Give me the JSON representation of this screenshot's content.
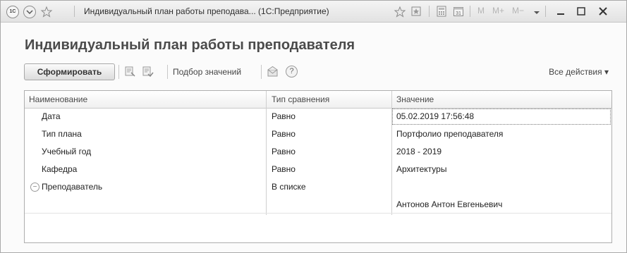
{
  "titlebar": {
    "logo_text": "1С",
    "title": "Индивидуальный план работы преподава...  (1С:Предприятие)",
    "memory_buttons": [
      "M",
      "M+",
      "M−"
    ],
    "icons": [
      "back-icon",
      "star-icon",
      "favorites-icon",
      "bookmark-icon",
      "calculator-icon",
      "calendar-icon",
      "dropdown-icon",
      "minimize-icon",
      "maximize-icon",
      "close-icon"
    ]
  },
  "form": {
    "title": "Индивидуальный план работы преподавателя"
  },
  "toolbar": {
    "generate_label": "Сформировать",
    "select_values_label": "Подбор значений",
    "help_label": "?",
    "all_actions_label": "Все действия ▾"
  },
  "table": {
    "columns": [
      "Наименование",
      "Тип сравнения",
      "Значение"
    ],
    "rows": [
      {
        "name": "Дата",
        "comparison": "Равно",
        "value": "05.02.2019 17:56:48"
      },
      {
        "name": "Тип плана",
        "comparison": "Равно",
        "value": "Портфолио преподавателя"
      },
      {
        "name": "Учебный год",
        "comparison": "Равно",
        "value": "2018 - 2019"
      },
      {
        "name": "Кафедра",
        "comparison": "Равно",
        "value": "Архитектуры"
      },
      {
        "name": "Преподаватель",
        "comparison": "В списке",
        "value": ""
      },
      {
        "name": "",
        "comparison": "",
        "value": "Антонов Антон Евгеньевич"
      }
    ]
  }
}
